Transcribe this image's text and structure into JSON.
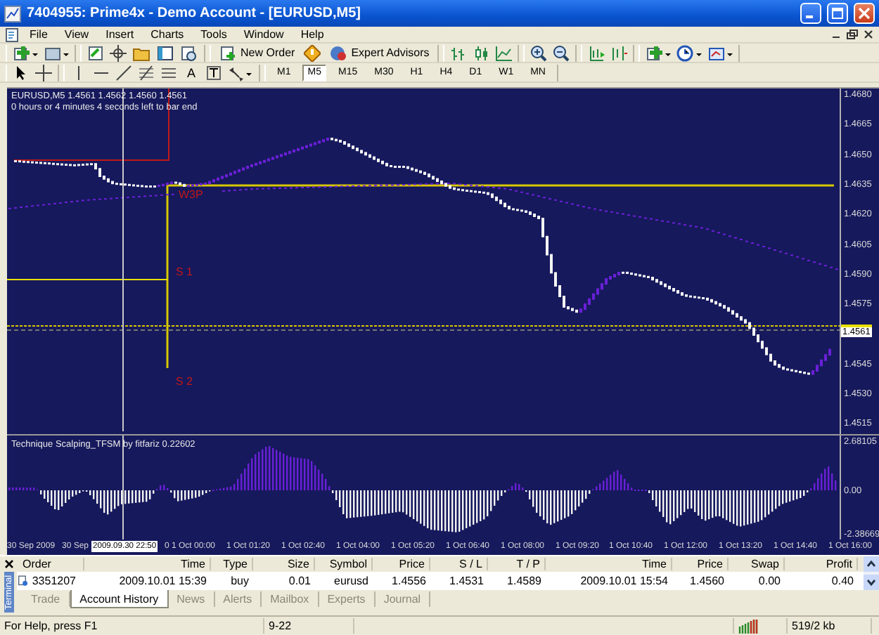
{
  "window": {
    "title": "7404955: Prime4x - Demo Account - [EURUSD,M5]"
  },
  "menu": [
    "File",
    "View",
    "Insert",
    "Charts",
    "Tools",
    "Window",
    "Help"
  ],
  "toolbar": {
    "new_order": "New Order",
    "expert_advisors": "Expert Advisors",
    "text_tool": "A"
  },
  "timeframes": [
    {
      "label": "M1",
      "selected": false
    },
    {
      "label": "M5",
      "selected": true
    },
    {
      "label": "M15",
      "selected": false
    },
    {
      "label": "M30",
      "selected": false
    },
    {
      "label": "H1",
      "selected": false
    },
    {
      "label": "H4",
      "selected": false
    },
    {
      "label": "D1",
      "selected": false
    },
    {
      "label": "W1",
      "selected": false
    },
    {
      "label": "MN",
      "selected": false
    }
  ],
  "chart": {
    "symbol_info": "EURUSD,M5  1.4561 1.4562 1.4560 1.4561",
    "timer": "0 hours or 4 minutes 4 seconds left to bar end",
    "level_labels": [
      "W3P",
      "S 1",
      "S 2"
    ],
    "price_ticks": [
      "1.4680",
      "1.4665",
      "1.4650",
      "1.4635",
      "1.4620",
      "1.4605",
      "1.4590",
      "1.4575",
      "1.4545",
      "1.4530",
      "1.4515"
    ],
    "current_price": "1.4561",
    "indicator": {
      "title": "Technique Scalping_TFSM by fitfariz 0.22602",
      "ticks": [
        "2.68105",
        "0.00",
        "-2.38669"
      ]
    },
    "time_ticks": [
      "30 Sep 2009",
      "30 Sep",
      "0",
      "1 Oct 00:00",
      "1 Oct 01:20",
      "1 Oct 02:40",
      "1 Oct 04:00",
      "1 Oct 05:20",
      "1 Oct 06:40",
      "1 Oct 08:00",
      "1 Oct 09:20",
      "1 Oct 10:40",
      "1 Oct 12:00",
      "1 Oct 13:20",
      "1 Oct 14:40",
      "1 Oct 16:00"
    ],
    "crosshair_time": "2009.09.30 22:50"
  },
  "terminal": {
    "side_label": "Terminal",
    "columns": [
      "Order",
      "Time",
      "Type",
      "Size",
      "Symbol",
      "Price",
      "S / L",
      "T / P",
      "Time",
      "Price",
      "Swap",
      "Profit"
    ],
    "rows": [
      [
        "3351207",
        "2009.10.01 15:39",
        "buy",
        "0.01",
        "eurusd",
        "1.4556",
        "1.4531",
        "1.4589",
        "2009.10.01 15:54",
        "1.4560",
        "0.00",
        "0.40"
      ]
    ],
    "tabs": [
      {
        "label": "Trade",
        "selected": false
      },
      {
        "label": "Account History",
        "selected": true
      },
      {
        "label": "News",
        "selected": false
      },
      {
        "label": "Alerts",
        "selected": false
      },
      {
        "label": "Mailbox",
        "selected": false
      },
      {
        "label": "Experts",
        "selected": false
      },
      {
        "label": "Journal",
        "selected": false
      }
    ]
  },
  "status_bar": {
    "help": "For Help, press F1",
    "profile": "9-22",
    "traffic": "519/2 kb"
  }
}
